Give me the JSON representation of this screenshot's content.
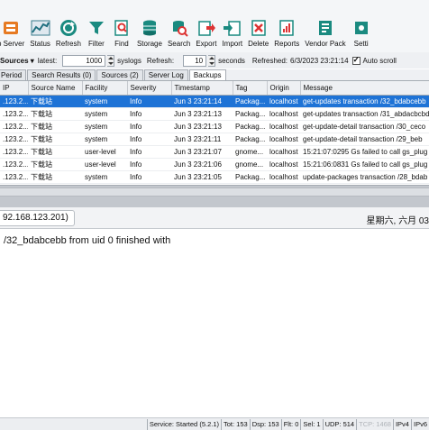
{
  "toolbar": {
    "items": [
      {
        "label": "p Server",
        "icon": "setup-server-icon"
      },
      {
        "label": "Status",
        "icon": "status-chart-icon"
      },
      {
        "label": "Refresh",
        "icon": "refresh-icon"
      },
      {
        "label": "Filter",
        "icon": "filter-icon"
      },
      {
        "label": "Find",
        "icon": "find-icon"
      },
      {
        "label": "Storage",
        "icon": "storage-icon"
      },
      {
        "label": "Search",
        "icon": "search-icon"
      },
      {
        "label": "Export",
        "icon": "export-icon"
      },
      {
        "label": "Import",
        "icon": "import-icon"
      },
      {
        "label": "Delete",
        "icon": "delete-icon"
      },
      {
        "label": "Reports",
        "icon": "reports-icon"
      },
      {
        "label": "Vendor Pack",
        "icon": "vendor-pack-icon"
      },
      {
        "label": "Setti",
        "icon": "settings-icon"
      }
    ]
  },
  "options": {
    "sources_label": "Sources",
    "latest_label": "latest:",
    "latest_value": "1000",
    "syslogs_label": "syslogs",
    "refresh_label": "Refresh:",
    "refresh_value": "10",
    "seconds_label": "seconds",
    "refreshed_label": "Refreshed:",
    "refreshed_value": "6/3/2023 23:21:14",
    "autoscroll_label": "Auto scroll",
    "autoscroll_checked": true
  },
  "tabs": [
    {
      "label": "Period",
      "active": false
    },
    {
      "label": "Search Results (0)",
      "active": false
    },
    {
      "label": "Sources (2)",
      "active": false
    },
    {
      "label": "Server Log",
      "active": false
    },
    {
      "label": "Backups",
      "active": true
    }
  ],
  "table": {
    "columns": [
      "IP",
      "Source Name",
      "Facility",
      "Severity",
      "Timestamp",
      "Tag",
      "Origin",
      "Message"
    ],
    "rows": [
      {
        "selected": true,
        "cells": [
          ".123.2...",
          "下载站",
          "system",
          "Info",
          "Jun  3 23:21:14",
          "Packag...",
          "localhost",
          "get-updates transaction /32_bdabcebb"
        ]
      },
      {
        "selected": false,
        "cells": [
          ".123.2...",
          "下载站",
          "system",
          "Info",
          "Jun  3 23:21:13",
          "Packag...",
          "localhost",
          "get-updates transaction /31_abdacbcbd"
        ]
      },
      {
        "selected": false,
        "cells": [
          ".123.2...",
          "下载站",
          "system",
          "Info",
          "Jun  3 23:21:13",
          "Packag...",
          "localhost",
          "get-update-detail transaction /30_ceco"
        ]
      },
      {
        "selected": false,
        "cells": [
          ".123.2...",
          "下载站",
          "system",
          "Info",
          "Jun  3 23:21:11",
          "Packag...",
          "localhost",
          "get-update-detail transaction /29_beb"
        ]
      },
      {
        "selected": false,
        "cells": [
          ".123.2...",
          "下载站",
          "user-level",
          "Info",
          "Jun  3 23:21:07",
          "gnome...",
          "localhost",
          "15:21:07:0295 Gs  failed to call gs_plug"
        ]
      },
      {
        "selected": false,
        "cells": [
          ".123.2...",
          "下载站",
          "user-level",
          "Info",
          "Jun  3 23:21:06",
          "gnome...",
          "localhost",
          "15:21:06:0831 Gs  failed to call gs_plug"
        ]
      },
      {
        "selected": false,
        "cells": [
          ".123.2...",
          "下载站",
          "system",
          "Info",
          "Jun  3 23:21:05",
          "Packag...",
          "localhost",
          "update-packages transaction /28_bdab"
        ]
      }
    ]
  },
  "detail": {
    "ip": "92.168.123.201)",
    "date": "星期六, 六月 03",
    "message": "/32_bdabcebb from uid 0 finished with"
  },
  "status": [
    {
      "label": "Service: Started (5.2.1)",
      "dim": false
    },
    {
      "label": "Tot: 153",
      "dim": false
    },
    {
      "label": "Dsp: 153",
      "dim": false
    },
    {
      "label": "Flt: 0",
      "dim": false
    },
    {
      "label": "Sel: 1",
      "dim": false
    },
    {
      "label": "UDP: 514",
      "dim": false
    },
    {
      "label": "TCP: 1468",
      "dim": true
    },
    {
      "label": "IPv4",
      "dim": false
    },
    {
      "label": "IPv6",
      "dim": false
    }
  ],
  "colors": {
    "selection": "#1e73d6",
    "toolbar_bg": "#f4f6f8"
  }
}
